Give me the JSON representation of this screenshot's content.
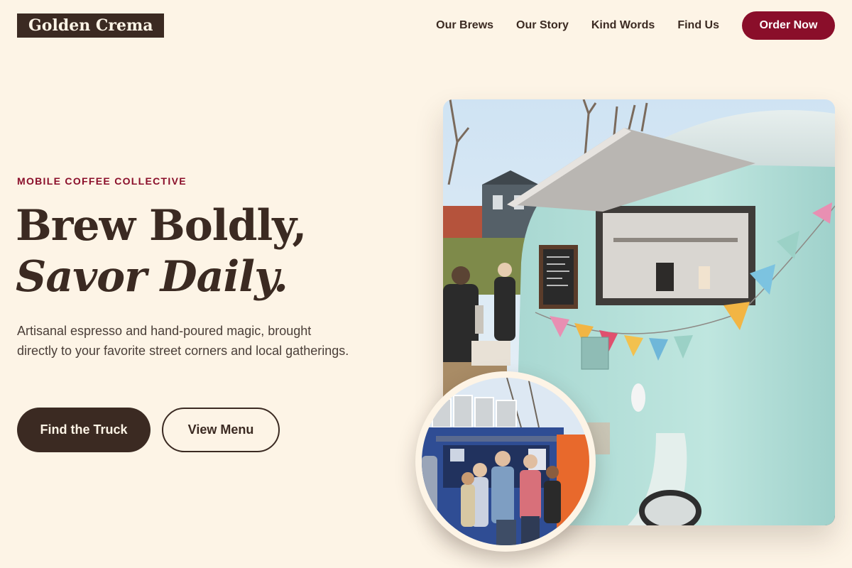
{
  "brand": {
    "name": "Golden Crema"
  },
  "nav": {
    "links": [
      "Our Brews",
      "Our Story",
      "Kind Words",
      "Find Us"
    ],
    "cta": "Order Now"
  },
  "hero": {
    "eyebrow": "MOBILE COFFEE COLLECTIVE",
    "headline_line1": "Brew Boldly,",
    "headline_line2": "Savor Daily.",
    "lede": "Artisanal espresso and hand-poured magic, brought directly to your favorite street corners and local gatherings.",
    "primary_cta": "Find the Truck",
    "secondary_cta": "View Menu"
  },
  "images": {
    "main": "vintage-coffee-van-photo",
    "inset": "pizza-food-truck-crowd-photo"
  },
  "colors": {
    "background": "#fdf4e6",
    "espresso": "#3b2a22",
    "accent": "#8a0e2a"
  }
}
